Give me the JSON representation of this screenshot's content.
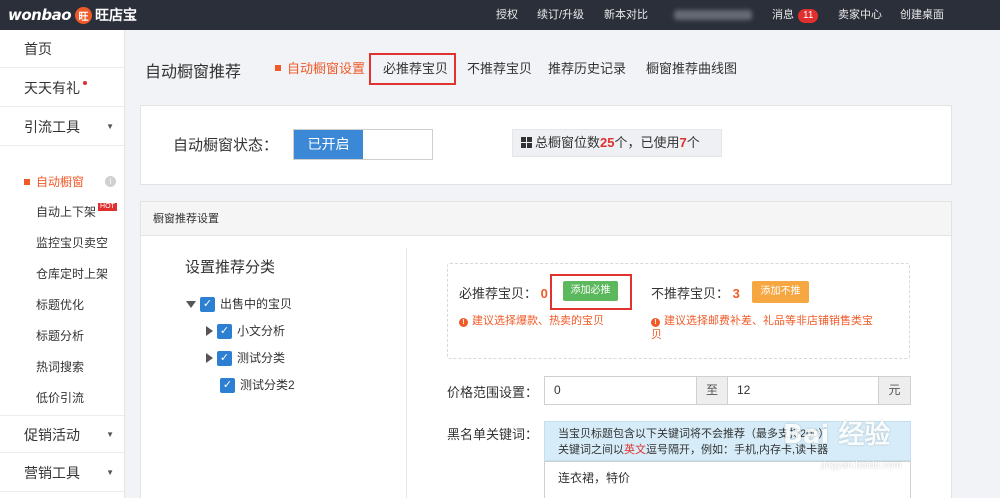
{
  "topbar": {
    "logo_text": "wonbao",
    "logo_badge": "旺",
    "logo_cn": "旺店宝",
    "nav": [
      "授权",
      "续订/升级",
      "新本对比"
    ],
    "messages_label": "消息",
    "messages_count": "11",
    "seller_center": "卖家中心",
    "create_desktop": "创建桌面"
  },
  "sidebar": {
    "home": "首页",
    "daily_gift": "天天有礼",
    "traffic_tools": "引流工具",
    "sub_items": [
      "自动橱窗",
      "自动上下架",
      "监控宝贝卖空",
      "仓库定时上架",
      "标题优化",
      "标题分析",
      "热词搜索",
      "低价引流"
    ],
    "hot_badge": "HOT",
    "promotions": "促销活动",
    "marketing": "营销工具"
  },
  "header": {
    "title": "自动橱窗推荐",
    "tabs": [
      "自动橱窗设置",
      "必推荐宝贝",
      "不推荐宝贝",
      "推荐历史记录",
      "橱窗推荐曲线图"
    ]
  },
  "status": {
    "label": "自动橱窗状态：",
    "toggle_on": "已开启",
    "total_prefix": "总橱窗位数",
    "total": "25",
    "mid": "个，已使用",
    "used": "7",
    "suffix": "个"
  },
  "settings": {
    "panel_title": "橱窗推荐设置",
    "tree_title": "设置推荐分类",
    "tree": [
      "出售中的宝贝",
      "小文分析",
      "测试分类",
      "测试分类2"
    ],
    "must_label": "必推荐宝贝：",
    "must_count": "0",
    "add_must": "添加必推",
    "must_tip": "建议选择爆款、热卖的宝贝",
    "not_label": "不推荐宝贝：",
    "not_count": "3",
    "add_not": "添加不推",
    "not_tip_1": "建议选择邮费补差、礼品等非店铺销售类宝",
    "not_tip_2": "贝",
    "price_label": "价格范围设置：",
    "price_min": "0",
    "price_to": "至",
    "price_max": "12",
    "price_unit": "元",
    "blacklist_label": "黑名单关键词：",
    "bl_line1": "当宝贝标题包含以下关键词将不会推荐（最多支持200）",
    "bl_line2_a": "关键词之间以",
    "bl_line2_red": "英文",
    "bl_line2_b": "逗号隔开，例如：手机,内存卡,读卡器",
    "bl_value": "连衣裙，特价"
  },
  "watermark": {
    "main": "Bai 经验",
    "sub": "jingyan.baidu.com"
  }
}
